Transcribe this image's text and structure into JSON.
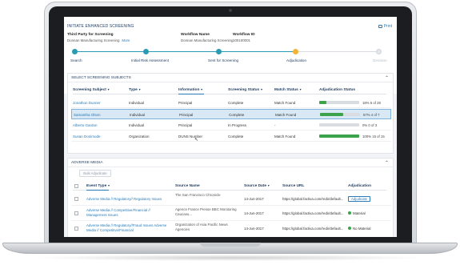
{
  "page": {
    "title": "INITIATE ENHANCED SCREENING",
    "print_label": "Print"
  },
  "fields": {
    "third_party_label": "Third Party for Screening",
    "third_party_value": "Donnan Manufacturing Screening",
    "more_label": "More",
    "workflow_name_label": "Workflow Name",
    "workflow_name_value": "Donnan Manufacturing Screening",
    "workflow_id_label": "Workflow ID",
    "workflow_id_value": "100100001"
  },
  "stepper": {
    "steps": [
      {
        "label": "Search",
        "state": "done"
      },
      {
        "label": "Initial Risk Assessment",
        "state": "done"
      },
      {
        "label": "Sent for Screening",
        "state": "done"
      },
      {
        "label": "Adjudication",
        "state": "active"
      },
      {
        "label": "Decision",
        "state": "pending"
      }
    ]
  },
  "subjects": {
    "title": "SELECT SCREENING SUBJECTS",
    "columns": [
      "Screening Subject",
      "Type",
      "Information",
      "Screening Status",
      "Match Status",
      "Adjudication Status"
    ],
    "rows": [
      {
        "subject": "Jonathon Dunner",
        "type": "Individual",
        "information": "Principal",
        "status": "Complete",
        "match": "Match Found",
        "progress": 0.18,
        "progress_text": "18%  5 of 28"
      },
      {
        "subject": "Samantha Olsen",
        "type": "Individual",
        "information": "Principal",
        "status": "Complete",
        "match": "Match Found",
        "progress": 0.57,
        "progress_text": "57%  4 of 7"
      },
      {
        "subject": "Alberto Gardon",
        "type": "Individual",
        "information": "Principal",
        "status": "In Progress",
        "match": "-",
        "progress": 0.0,
        "progress_text": "0%  0 of 3"
      },
      {
        "subject": "Susan Donimode",
        "type": "Organization",
        "information": "DUNS Number",
        "status": "Complete",
        "match": "Match Found",
        "progress": 1.0,
        "progress_text": "100%  15 of 15"
      }
    ]
  },
  "adverse_media": {
    "title": "ADVERSE MEDIA",
    "bulk_label": "Bulk Adjudicate",
    "columns": [
      "Event Type",
      "Source Name",
      "Source Date",
      "Source URL",
      "Adjudication"
    ],
    "rows": [
      {
        "event": "Adverse Media // Regulatory// Regulatory Issues",
        "source": "The San Francisco Chronicle",
        "date": "14-Jun-2017",
        "url": "https://global.factiva.com/redir/default...",
        "adjudication": "Adjudicate"
      },
      {
        "event": "Adverse Media // Competitive/Financial // Management Issues",
        "source": "Agence France Presse BBC Monitoring Caucasu...",
        "date": "14-Jun-2017",
        "url": "https://global.factiva.com/redir/default...",
        "adjudication": "Material"
      },
      {
        "event": "Adverse Media // Regulatory//Fraud Issues Adverse Media // Competitive/Financial",
        "source": "Organization of Asia Pacific News Agencies",
        "date": "14-Jun-2017",
        "url": "https://global.factiva.com/redir/default...",
        "adjudication": "No Material"
      }
    ]
  },
  "colors": {
    "accent": "#2a7bb8",
    "step_done": "#2a9bb5",
    "step_active": "#f5b335",
    "progress": "#3ba34b",
    "selected_row": "#d8e8f5"
  }
}
